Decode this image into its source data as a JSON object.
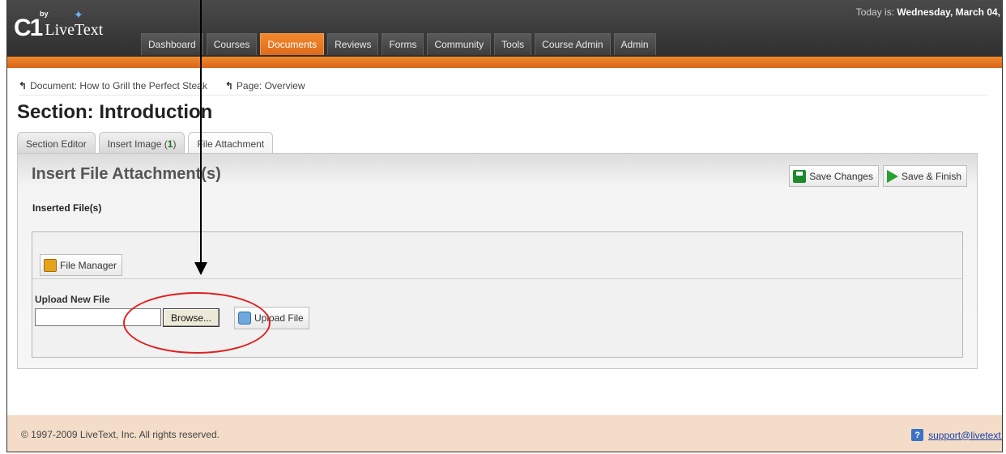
{
  "header": {
    "logo_by": "by",
    "logo_c1": "C1",
    "logo_text": "LiveText",
    "today_prefix": "Today is:",
    "today_date": "Wednesday, March 04,"
  },
  "nav": {
    "tabs": [
      {
        "label": "Dashboard"
      },
      {
        "label": "Courses"
      },
      {
        "label": "Documents",
        "active": true
      },
      {
        "label": "Reviews"
      },
      {
        "label": "Forms"
      },
      {
        "label": "Community"
      },
      {
        "label": "Tools"
      },
      {
        "label": "Course Admin"
      },
      {
        "label": "Admin"
      }
    ]
  },
  "breadcrumbs": [
    {
      "label": "Document: How to Grill the Perfect Steak"
    },
    {
      "label": "Page: Overview"
    }
  ],
  "page_title": "Section: Introduction",
  "tabs": {
    "section_editor": "Section Editor",
    "insert_image": "Insert Image (",
    "insert_image_count": "1",
    "insert_image_close": ")",
    "file_attachment": "File Attachment"
  },
  "panel": {
    "title": "Insert File Attachment(s)",
    "save_changes": "Save Changes",
    "save_finish": "Save & Finish",
    "inserted_files_label": "Inserted File(s)",
    "file_manager": "File Manager",
    "upload_new_file": "Upload New File",
    "file_input_value": "",
    "browse": "Browse...",
    "upload_file": "Upload File"
  },
  "footer": {
    "copyright": "© 1997-2009 LiveText, Inc. All rights reserved.",
    "support_email": "support@livetext.c"
  },
  "colors": {
    "header_dark": "#3a3a3a",
    "brand_orange": "#e0701f",
    "footer_bg": "#f3ddc8",
    "annotation_red": "#e02020"
  },
  "icons": [
    "up-arrow-icon",
    "save-icon",
    "finish-arrow-icon",
    "folder-icon",
    "upload-icon",
    "help-icon"
  ]
}
